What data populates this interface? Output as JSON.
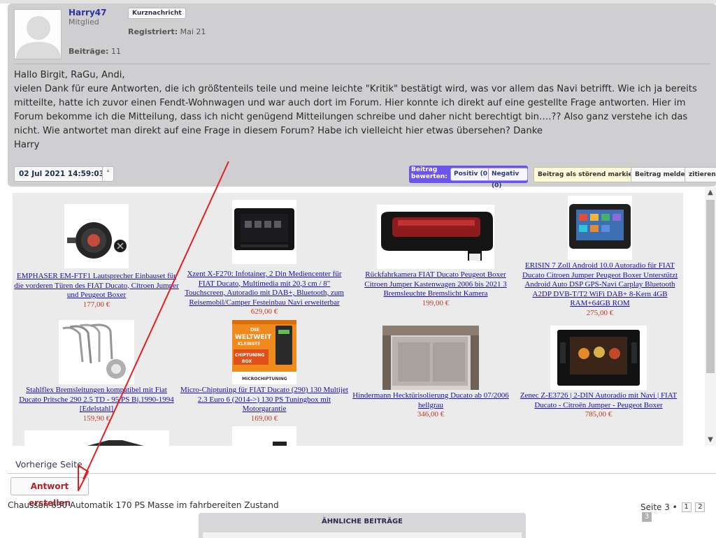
{
  "post": {
    "username": "Harry47",
    "rank": "Mitglied",
    "pm_label": "Kurznachricht",
    "registered_label": "Registriert:",
    "registered_value": "Mai 21",
    "posts_label": "Beiträge:",
    "posts_value": "11",
    "body": [
      "Hallo Birgit, RaGu, Andi,",
      "vielen Dank für eure Antworten, die ich größtenteils teile und meine leichte \"Kritik\" bestätigt wird, was vor allem das Navi betrifft. Wie ich ja bereits mitteilte, hatte ich zuvor einen Fendt-Wohnwagen und war auch dort im Forum. Hier konnte ich direkt auf eine gestellte Frage antworten. Hier im Forum bekomme ich die Mitteilung, dass ich nicht genügend Mitteilungen schreibe und daher nicht berechtigt bin….?? Also ganz verstehe ich das nicht. Wie antwortet man direkt auf eine Frage in diesem Forum? Habe ich vielleicht hier etwas übersehen? Danke",
      "Harry"
    ],
    "date": "02 Jul 2021 14:59:03",
    "up_icon": "caret-up-icon",
    "rate_label_1": "Beitrag",
    "rate_label_2": "bewerten:",
    "positive": "Positiv (0)",
    "negative": "Negativ (0)",
    "mark_label": "Beitrag als störend markieren",
    "report_label": "Beitrag melden",
    "quote_label": "zitieren"
  },
  "products": [
    {
      "title": "EMPHASER EM-FTF1 Lautsprecher Einbauset für die vorderen Türen des FIAT Ducato, Citroen Jumper und Peugeot Boxer",
      "price": "177,00 €"
    },
    {
      "title": "Xzent X-F270: Infotainer, 2 Din Mediencenter für FIAT Ducato, Multimedia mit 20,3 cm / 8\" Touchscreen, Autoradio mit DAB+, Bluetooth, zum Reisemobil/Camper Festeinbau Navi erweiterbar",
      "price": "629,00 €"
    },
    {
      "title": "Rückfahrkamera FIAT Ducato Peugeot Boxer Citroen Jumper Kastenwagen 2006 bis 2021 3 Bremsleuchte Bremslicht Kamera",
      "price": "199,00 €"
    },
    {
      "title": "ERISIN 7 Zoll Android 10.0 Autoradio für FIAT Ducato Citroen Jumper Peugeot Boxer Unterstützt Android Auto DSP GPS-Navi Carplay Bluetooth A2DP DVB-T/T2 WiFi DAB+ 8-Kern 4GB RAM+64GB ROM",
      "price": "275,00 €"
    },
    {
      "title": "Stahlflex Bremsleitungen kompatibel mit Fiat Ducato Pritsche 290 2.5 TD - 95 PS Bj.1990-1994 [Edelstahl]",
      "price": "159,90 €"
    },
    {
      "title": "Micro-Chiptuning für FIAT Ducato (290) 130 Multijet 2.3 Euro 6 (2014->) 130 PS Tuningbox mit Motorgarantie",
      "price": "169,00 €"
    },
    {
      "title": "Hindermann Hecktürisolierung Ducato ab 07/2006 hellgrau",
      "price": "346,00 €"
    },
    {
      "title": "Zenec Z-E3726 | 2-DIN Autoradio mit Navi | FIAT Ducato - Citroën Jumper - Peugeot Boxer",
      "price": "785,00 €"
    }
  ],
  "chip_box": {
    "line1": "DIE",
    "line2": "WELTWEIT",
    "line3": "KLEINSTE",
    "line4": "CHIPTUNING",
    "line5": "BOX",
    "brand": "MICROCHIPTUNING"
  },
  "scrollbar": {
    "up": "▲",
    "down": "▼"
  },
  "nav": {
    "prev_page": "Vorherige Seite",
    "reply": "Antwort erstellen",
    "topic_title": "Chausson 630 Automatik 170 PS Masse im fahrbereiten Zustand",
    "page_label": "Seite 3 •",
    "pages": [
      "1",
      "2",
      "3"
    ],
    "similar_title": "ÄHNLICHE BEITRÄGE"
  },
  "colors": {
    "accent_rate": "#6b55ee",
    "link": "#1a0dab",
    "price": "#c0392b",
    "arrow": "#e02020",
    "reply": "#b0222b"
  }
}
